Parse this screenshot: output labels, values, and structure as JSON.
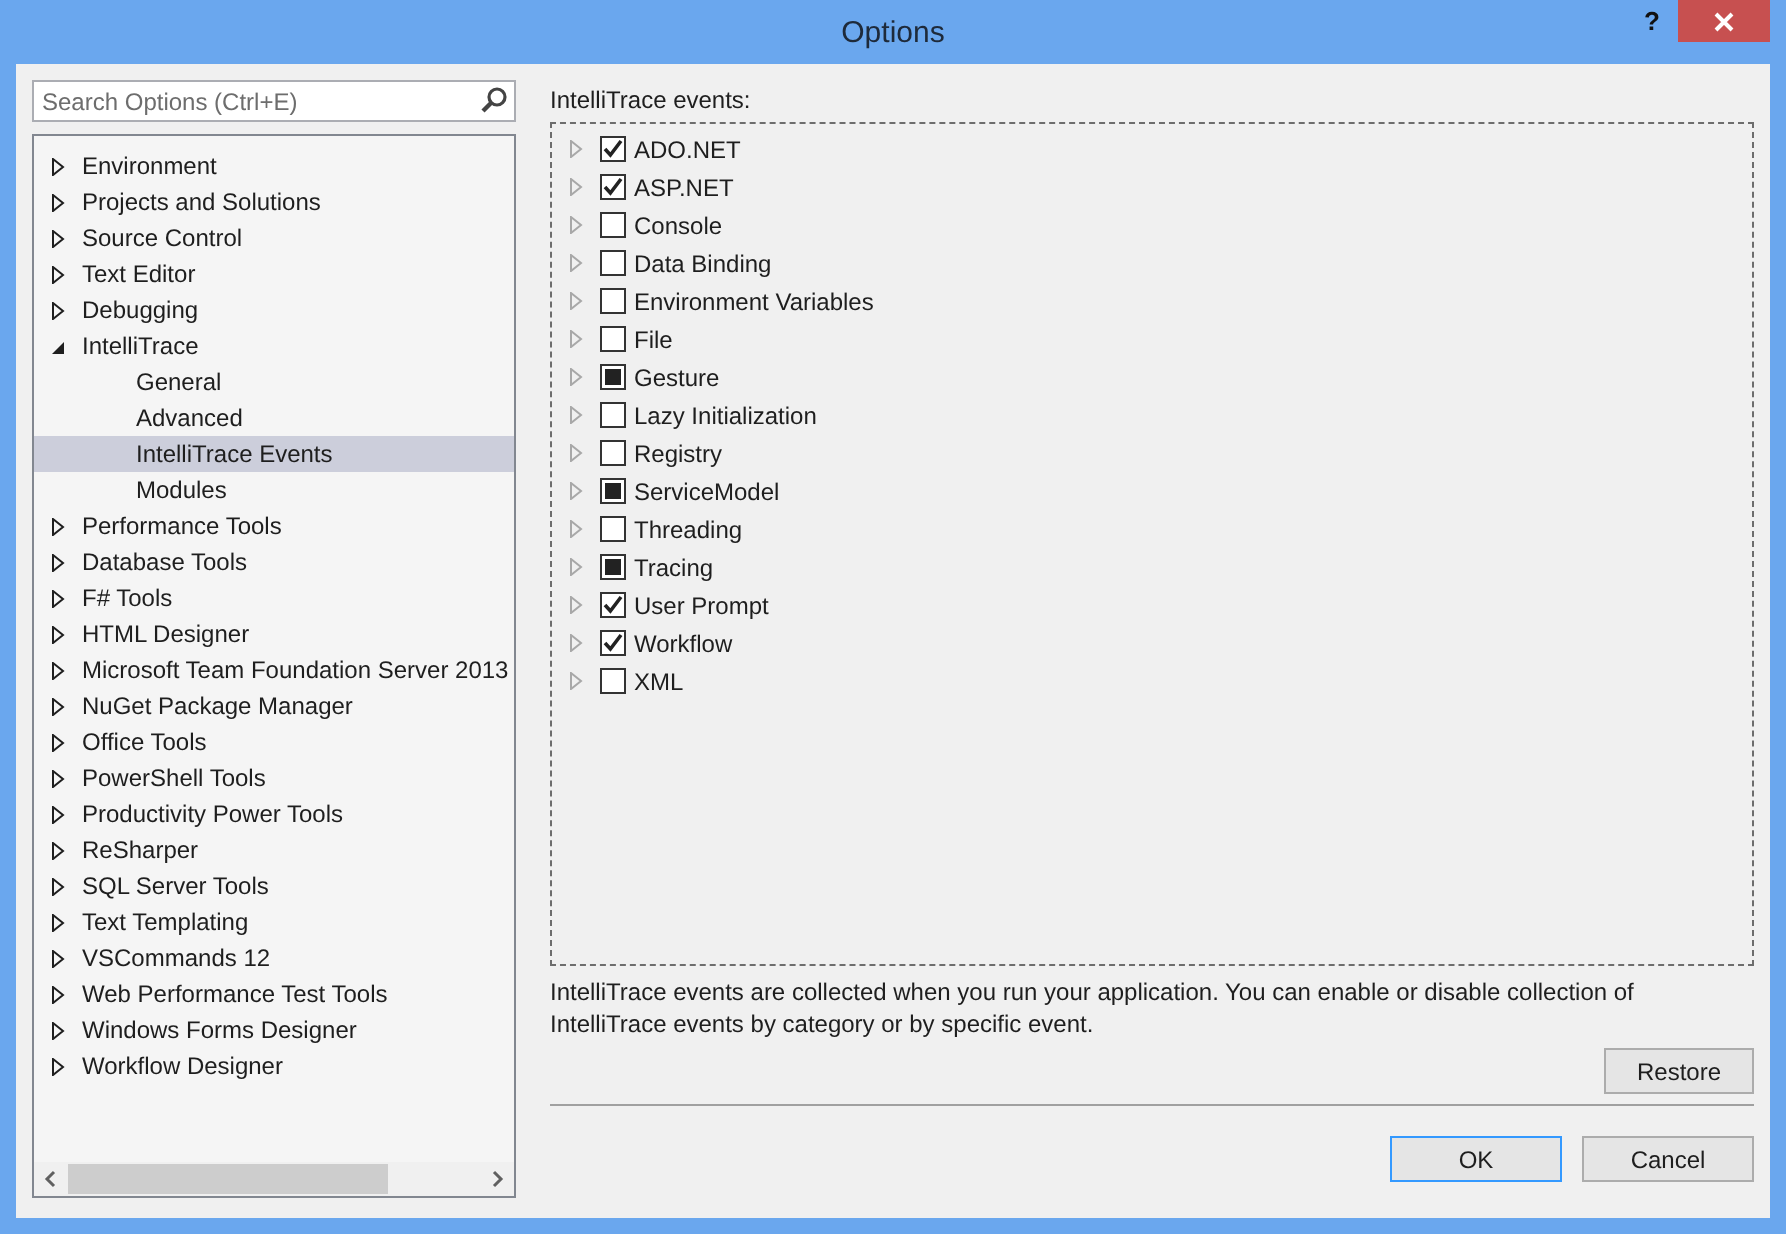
{
  "window": {
    "title": "Options",
    "help": "?"
  },
  "search": {
    "placeholder": "Search Options (Ctrl+E)"
  },
  "tree": [
    {
      "label": "Environment",
      "expanded": false,
      "selected": false
    },
    {
      "label": "Projects and Solutions",
      "expanded": false,
      "selected": false
    },
    {
      "label": "Source Control",
      "expanded": false,
      "selected": false
    },
    {
      "label": "Text Editor",
      "expanded": false,
      "selected": false
    },
    {
      "label": "Debugging",
      "expanded": false,
      "selected": false
    },
    {
      "label": "IntelliTrace",
      "expanded": true,
      "selected": false,
      "children": [
        {
          "label": "General",
          "selected": false
        },
        {
          "label": "Advanced",
          "selected": false
        },
        {
          "label": "IntelliTrace Events",
          "selected": true
        },
        {
          "label": "Modules",
          "selected": false
        }
      ]
    },
    {
      "label": "Performance Tools",
      "expanded": false,
      "selected": false
    },
    {
      "label": "Database Tools",
      "expanded": false,
      "selected": false
    },
    {
      "label": "F# Tools",
      "expanded": false,
      "selected": false
    },
    {
      "label": "HTML Designer",
      "expanded": false,
      "selected": false
    },
    {
      "label": "Microsoft Team Foundation Server 2013",
      "expanded": false,
      "selected": false
    },
    {
      "label": "NuGet Package Manager",
      "expanded": false,
      "selected": false
    },
    {
      "label": "Office Tools",
      "expanded": false,
      "selected": false
    },
    {
      "label": "PowerShell Tools",
      "expanded": false,
      "selected": false
    },
    {
      "label": "Productivity Power Tools",
      "expanded": false,
      "selected": false
    },
    {
      "label": "ReSharper",
      "expanded": false,
      "selected": false
    },
    {
      "label": "SQL Server Tools",
      "expanded": false,
      "selected": false
    },
    {
      "label": "Text Templating",
      "expanded": false,
      "selected": false
    },
    {
      "label": "VSCommands 12",
      "expanded": false,
      "selected": false
    },
    {
      "label": "Web Performance Test Tools",
      "expanded": false,
      "selected": false
    },
    {
      "label": "Windows Forms Designer",
      "expanded": false,
      "selected": false
    },
    {
      "label": "Workflow Designer",
      "expanded": false,
      "selected": false
    }
  ],
  "events_label": "IntelliTrace events:",
  "events": [
    {
      "label": "ADO.NET",
      "checked": true,
      "indeterminate": false
    },
    {
      "label": "ASP.NET",
      "checked": true,
      "indeterminate": false
    },
    {
      "label": "Console",
      "checked": false,
      "indeterminate": false
    },
    {
      "label": "Data Binding",
      "checked": false,
      "indeterminate": false
    },
    {
      "label": "Environment Variables",
      "checked": false,
      "indeterminate": false
    },
    {
      "label": "File",
      "checked": false,
      "indeterminate": false
    },
    {
      "label": "Gesture",
      "checked": false,
      "indeterminate": true
    },
    {
      "label": "Lazy Initialization",
      "checked": false,
      "indeterminate": false
    },
    {
      "label": "Registry",
      "checked": false,
      "indeterminate": false
    },
    {
      "label": "ServiceModel",
      "checked": false,
      "indeterminate": true
    },
    {
      "label": "Threading",
      "checked": false,
      "indeterminate": false
    },
    {
      "label": "Tracing",
      "checked": false,
      "indeterminate": true
    },
    {
      "label": "User Prompt",
      "checked": true,
      "indeterminate": false
    },
    {
      "label": "Workflow",
      "checked": true,
      "indeterminate": false
    },
    {
      "label": "XML",
      "checked": false,
      "indeterminate": false
    }
  ],
  "description": "IntelliTrace events are collected when you run your application. You can enable or disable collection of IntelliTrace events by category or by specific event.",
  "restore_button": "Restore",
  "buttons": [
    {
      "label": "OK",
      "default": true
    },
    {
      "label": "Cancel",
      "default": false
    }
  ]
}
